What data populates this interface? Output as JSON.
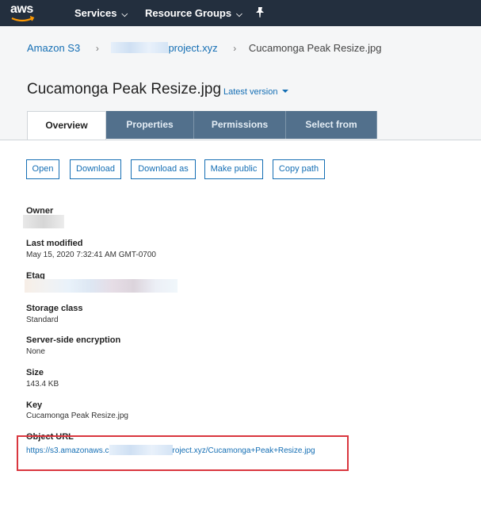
{
  "topbar": {
    "logo_text": "aws",
    "services_label": "Services",
    "resource_groups_label": "Resource Groups",
    "chevron": "⌄",
    "pin_icon": "pin-icon"
  },
  "breadcrumb": {
    "root": "Amazon S3",
    "bucket_suffix": "project.xyz",
    "current": "Cucamonga Peak Resize.jpg",
    "separator": "›"
  },
  "object": {
    "title": "Cucamonga Peak Resize.jpg",
    "version_label": "Latest version"
  },
  "tabs": [
    {
      "label": "Overview",
      "active": true
    },
    {
      "label": "Properties",
      "active": false
    },
    {
      "label": "Permissions",
      "active": false
    },
    {
      "label": "Select from",
      "active": false
    }
  ],
  "actions": {
    "open": "Open",
    "download": "Download",
    "download_as": "Download as",
    "make_public": "Make public",
    "copy_path": "Copy path"
  },
  "properties": {
    "owner_label": "Owner",
    "last_modified_label": "Last modified",
    "last_modified_value": "May 15, 2020 7:32:41 AM GMT-0700",
    "etag_label": "Etag",
    "storage_class_label": "Storage class",
    "storage_class_value": "Standard",
    "encryption_label": "Server-side encryption",
    "encryption_value": "None",
    "size_label": "Size",
    "size_value": "143.4 KB",
    "key_label": "Key",
    "key_value": "Cucamonga Peak Resize.jpg",
    "object_url_label": "Object URL",
    "object_url_prefix": "https://s3.amazonaws.c",
    "object_url_suffix": "roject.xyz/Cucamonga+Peak+Resize.jpg"
  },
  "colors": {
    "nav_bg": "#232f3e",
    "link": "#146eb4",
    "tab_inactive": "#52708c",
    "highlight": "#d9363e"
  }
}
